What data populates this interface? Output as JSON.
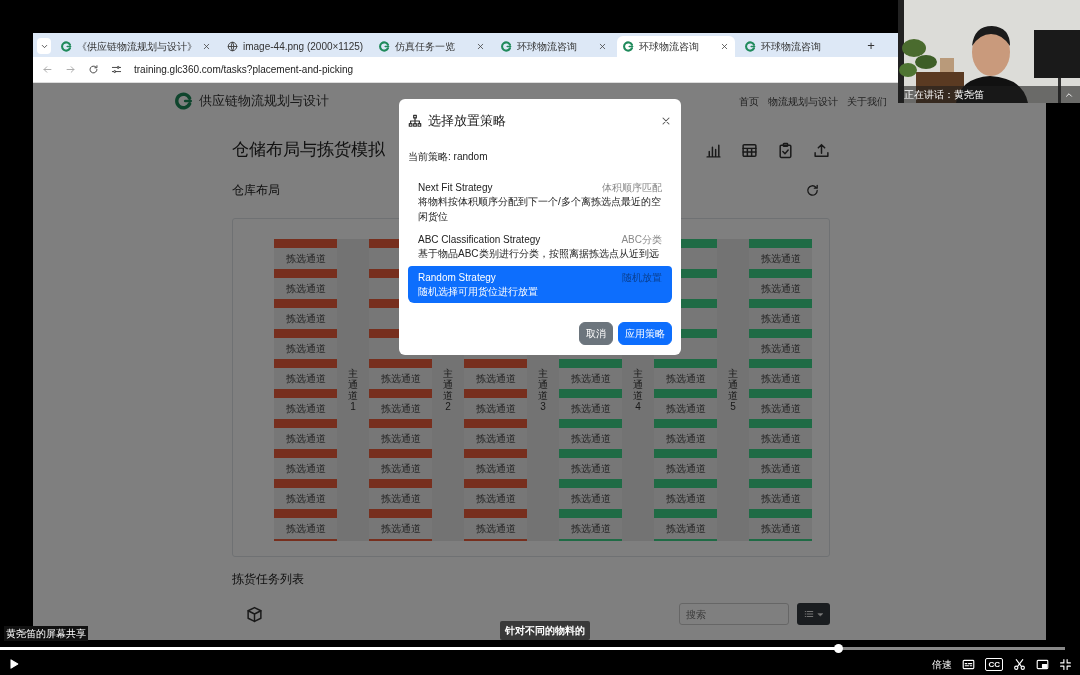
{
  "browser": {
    "tabs": [
      {
        "title": "《供应链物流规划与设计》",
        "kind": "page",
        "close_button": true,
        "selected": false
      },
      {
        "title": "image-44.png (2000×1125)",
        "close_button": false,
        "selected": false
      },
      {
        "title": "仿真任务一览",
        "kind": "page",
        "close_button": true,
        "selected": false
      },
      {
        "title": "环球物流咨询",
        "kind": "page",
        "close_button": true,
        "selected": false
      },
      {
        "title": "环球物流咨询",
        "kind": "page",
        "close_button": true,
        "selected": true
      },
      {
        "title": "环球物流咨询",
        "kind": "page",
        "close_button": false,
        "selected": false
      }
    ],
    "new_tab": "+",
    "address": "training.glc360.com/tasks?placement-and-picking"
  },
  "page": {
    "brand": "供应链物流规划与设计",
    "nav": [
      "首页",
      "物流规划与设计",
      "关于我们"
    ],
    "title": "仓储布局与拣货模拟",
    "layout_heading": "仓库布局",
    "racks": [
      {
        "color": "#772f1e",
        "rows": [
          "拣选通道",
          "拣选通道",
          "拣选通道",
          "拣选通道",
          "拣选通道",
          "拣选通道",
          "拣选通道",
          "拣选通道",
          "拣选通道",
          "拣选通道"
        ]
      },
      {
        "color": "#772f1e",
        "rows": [
          "拣选通道",
          "拣选通道",
          "拣选通道",
          "拣选通道",
          "拣选通道",
          "拣选通道"
        ]
      },
      {
        "color": "#772f1e",
        "rows": [
          "拣选通道",
          "拣选通道",
          "拣选通道",
          "拣选通道",
          "拣选通道",
          "拣选通道"
        ]
      },
      {
        "color": "#1f6b45",
        "rows": [
          "拣选通道",
          "拣选通道",
          "拣选通道",
          "拣选通道",
          "拣选通道",
          "拣选通道"
        ]
      },
      {
        "color": "#1f6b45",
        "rows": [
          "拣选通道",
          "拣选通道",
          "拣选通道",
          "拣选通道",
          "拣选通道",
          "拣选通道"
        ]
      },
      {
        "color": "#1f6b45",
        "rows": [
          "拣选通道",
          "拣选通道",
          "拣选通道",
          "拣选通道",
          "拣选通道",
          "拣选通道",
          "拣选通道",
          "拣选通道",
          "拣选通道",
          "拣选通道"
        ]
      }
    ],
    "main_aisles": [
      "主通道 1",
      "主通道 2",
      "主通道 3",
      "主通道 4",
      "主通道 5"
    ],
    "task_heading": "拣货任务列表",
    "search": {
      "placeholder": "搜索"
    }
  },
  "modal": {
    "title": "选择放置策略",
    "current": "当前策略: random",
    "strategies": [
      {
        "name": "Next Fit Strategy",
        "tag": "体积顺序匹配",
        "description": "将物料按体积顺序分配到下一个/多个离拣选点最近的空闲货位",
        "selected": false
      },
      {
        "name": "ABC Classification Strategy",
        "tag": "ABC分类",
        "description": "基于物品ABC类别进行分类，按照离据拣选点从近到远",
        "selected": false
      },
      {
        "name": "Random Strategy",
        "tag": "随机放置",
        "description": "随机选择可用货位进行放置",
        "selected": true
      }
    ],
    "buttons": [
      {
        "label": "取消",
        "kind": "secondary"
      },
      {
        "label": "应用策略",
        "kind": "primary"
      }
    ]
  },
  "webcam": {
    "speaker_label": "正在讲话：黄尧笛"
  },
  "player": {
    "presenter_label": "黄尧笛的屏幕共享",
    "caption": "针对不同的物料的",
    "progress": {
      "level": 0.787
    },
    "speed_label": "倍速",
    "cc_label": "CC"
  }
}
